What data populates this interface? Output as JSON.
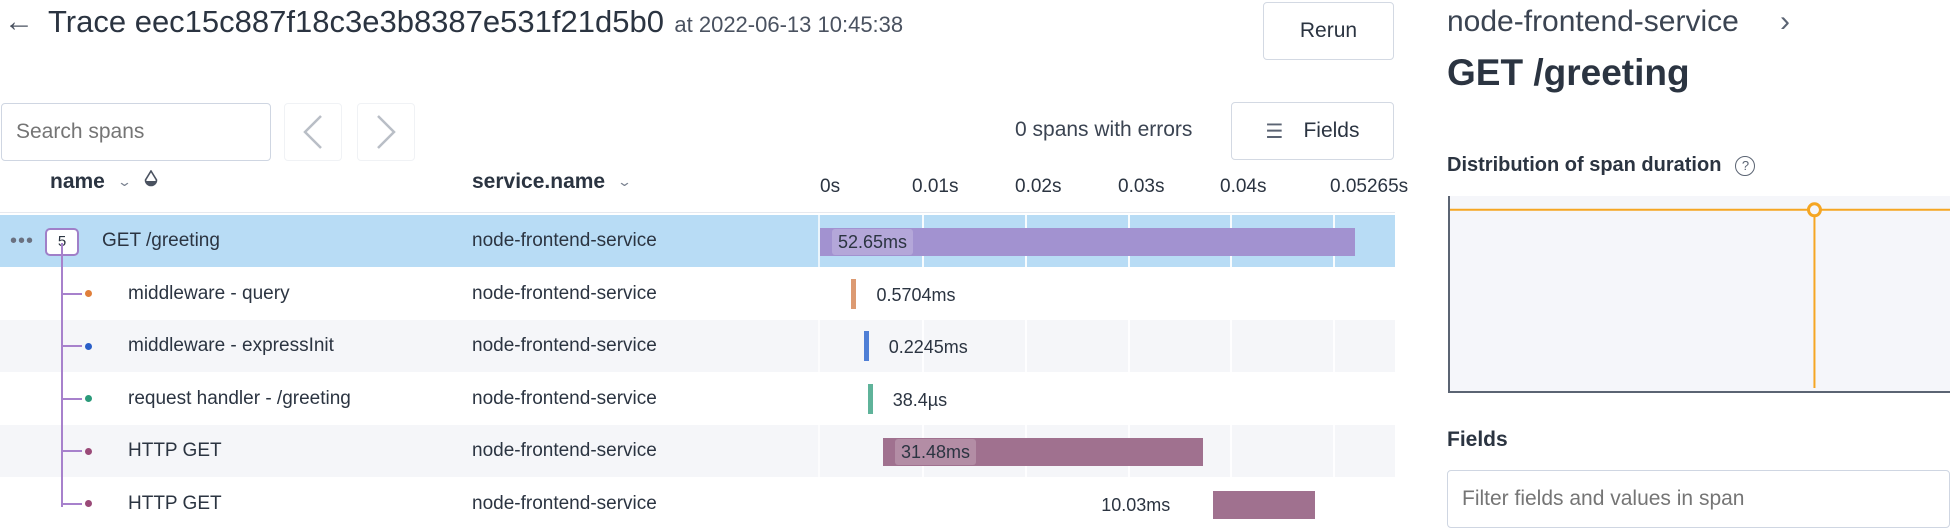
{
  "header": {
    "back_icon": "arrow-left-icon",
    "trace_label": "Trace eec15c887f18c3e3b8387e531f21d5b0",
    "timestamp_label": "at 2022-06-13 10:45:38",
    "rerun_label": "Rerun"
  },
  "toolbar": {
    "search_placeholder": "Search spans",
    "prev_icon": "chevron-left-icon",
    "next_icon": "chevron-right-icon",
    "errors_text": "0 spans with errors",
    "fields_label": "Fields",
    "fields_icon": "columns-list-icon"
  },
  "table": {
    "columns": {
      "name": "name",
      "service": "service.name"
    },
    "timeline_ticks": [
      "0s",
      "0.01s",
      "0.02s",
      "0.03s",
      "0.04s",
      "0.05265s"
    ],
    "timeline_max_s": 0.05265,
    "child_count": "5",
    "rows": [
      {
        "name": "GET /greeting",
        "service": "node-frontend-service",
        "duration": "52.65ms",
        "start_s": 0.0,
        "duration_s": 0.05265,
        "color": "#a292d0",
        "dot_color": "",
        "selected": true,
        "label_pos": "inside"
      },
      {
        "name": "middleware - query",
        "service": "node-frontend-service",
        "duration": "0.5704ms",
        "start_s": 0.0031,
        "duration_s": 0.0005704,
        "color": "#dc9a72",
        "dot_color": "#e07f3b",
        "selected": false,
        "label_pos": "after"
      },
      {
        "name": "middleware - expressInit",
        "service": "node-frontend-service",
        "duration": "0.2245ms",
        "start_s": 0.0043,
        "duration_s": 0.0002245,
        "color": "#4f7fd6",
        "dot_color": "#2a5fc8",
        "selected": false,
        "label_pos": "after"
      },
      {
        "name": "request handler - /greeting",
        "service": "node-frontend-service",
        "duration": "38.4µs",
        "start_s": 0.0047,
        "duration_s": 3.84e-05,
        "color": "#5fb39a",
        "dot_color": "#2b9a7a",
        "selected": false,
        "label_pos": "after"
      },
      {
        "name": "HTTP GET",
        "service": "node-frontend-service",
        "duration": "31.48ms",
        "start_s": 0.0062,
        "duration_s": 0.03148,
        "color": "#a0718f",
        "dot_color": "#9a4a78",
        "selected": false,
        "label_pos": "inside"
      },
      {
        "name": "HTTP GET",
        "service": "node-frontend-service",
        "duration": "10.03ms",
        "start_s": 0.0387,
        "duration_s": 0.01003,
        "color": "#a0718f",
        "dot_color": "#9a4a78",
        "selected": false,
        "label_pos": "before"
      }
    ]
  },
  "detail_panel": {
    "service_name": "node-frontend-service",
    "span_name": "GET /greeting",
    "distribution_title": "Distribution of span duration",
    "help_icon": "question-circle-icon",
    "fields_title": "Fields",
    "filter_placeholder": "Filter fields and values in span",
    "highlight_color": "#f5a623",
    "marker_position_fraction": 0.73,
    "threshold_line_fraction": 0.07
  }
}
